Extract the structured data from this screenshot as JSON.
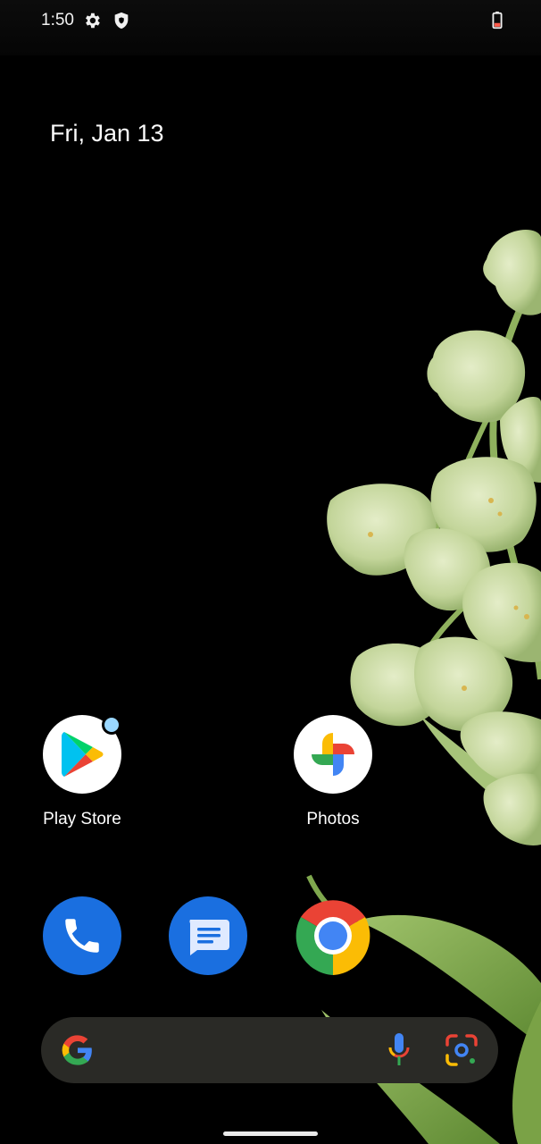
{
  "status_bar": {
    "time": "1:50",
    "icons": [
      "gear-icon",
      "shield-icon",
      "battery-low-icon"
    ],
    "battery_color": "#ff5a4a"
  },
  "date_widget": {
    "text": "Fri, Jan 13"
  },
  "apps": [
    {
      "label": "Play Store",
      "icon": "play-store-icon",
      "has_notification_dot": true
    },
    {
      "label": "Photos",
      "icon": "photos-icon",
      "has_notification_dot": false
    }
  ],
  "dock": [
    {
      "icon": "phone-icon",
      "color": "#1a6fe0"
    },
    {
      "icon": "messages-icon",
      "color": "#1a6fe0"
    },
    {
      "icon": "chrome-icon"
    }
  ],
  "search_bar": {
    "icons": [
      "google-g-icon",
      "microphone-icon",
      "google-lens-icon"
    ],
    "background": "#2a2a26"
  },
  "colors": {
    "google_blue": "#4285F4",
    "google_red": "#EA4335",
    "google_yellow": "#FBBC05",
    "google_green": "#34A853",
    "wallpaper_flower": "#c8d9a4",
    "wallpaper_leaf": "#7fa84e"
  }
}
